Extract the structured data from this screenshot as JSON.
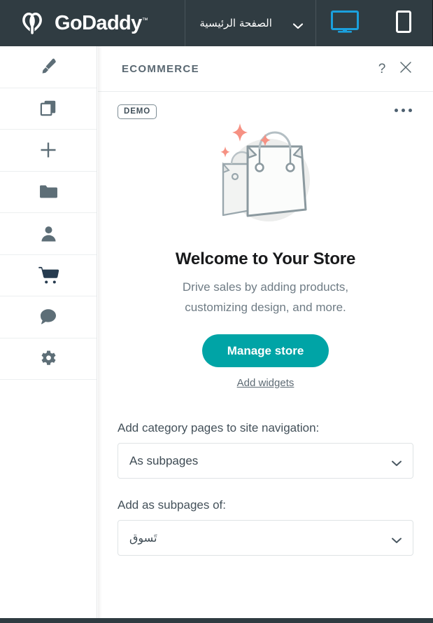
{
  "topbar": {
    "brand_name": "GoDaddy",
    "brand_tm": "™",
    "page_selector_label": "الصفحة الرئيسية",
    "desktop_icon": "desktop-monitor-icon",
    "mobile_icon": "mobile-phone-icon",
    "desktop_active_color": "#1ba0dd",
    "mobile_color": "#ffffff",
    "background_color": "#303c42"
  },
  "sidebar": {
    "items": [
      {
        "name": "design",
        "icon": "paintbrush-icon",
        "active": false
      },
      {
        "name": "pages",
        "icon": "copy-pages-icon",
        "active": false
      },
      {
        "name": "add",
        "icon": "plus-icon",
        "active": false
      },
      {
        "name": "media",
        "icon": "folder-icon",
        "active": false
      },
      {
        "name": "account",
        "icon": "person-icon",
        "active": false
      },
      {
        "name": "ecommerce",
        "icon": "shopping-cart-icon",
        "active": true
      },
      {
        "name": "messages",
        "icon": "chat-bubble-icon",
        "active": false
      },
      {
        "name": "settings",
        "icon": "gear-icon",
        "active": false
      }
    ],
    "icon_color": "#5d6e77",
    "active_icon_color": "#263b4f"
  },
  "panel": {
    "title": "ECOMMERCE",
    "help_label": "?",
    "close_label": "✕",
    "more_label": "more-options",
    "badge": "DEMO",
    "illustration": "shopping-bags-illustration",
    "welcome_title": "Welcome to Your Store",
    "welcome_subtitle_line1": "Drive sales by adding products,",
    "welcome_subtitle_line2": "customizing design, and more.",
    "cta_label": "Manage store",
    "cta_color": "#00a4a6",
    "secondary_link_label": "Add widgets",
    "fields": [
      {
        "label": "Add category pages to site navigation:",
        "value": "As subpages",
        "rtl": false
      },
      {
        "label": "Add as subpages of:",
        "value": "تَسوق",
        "rtl": true
      }
    ]
  }
}
